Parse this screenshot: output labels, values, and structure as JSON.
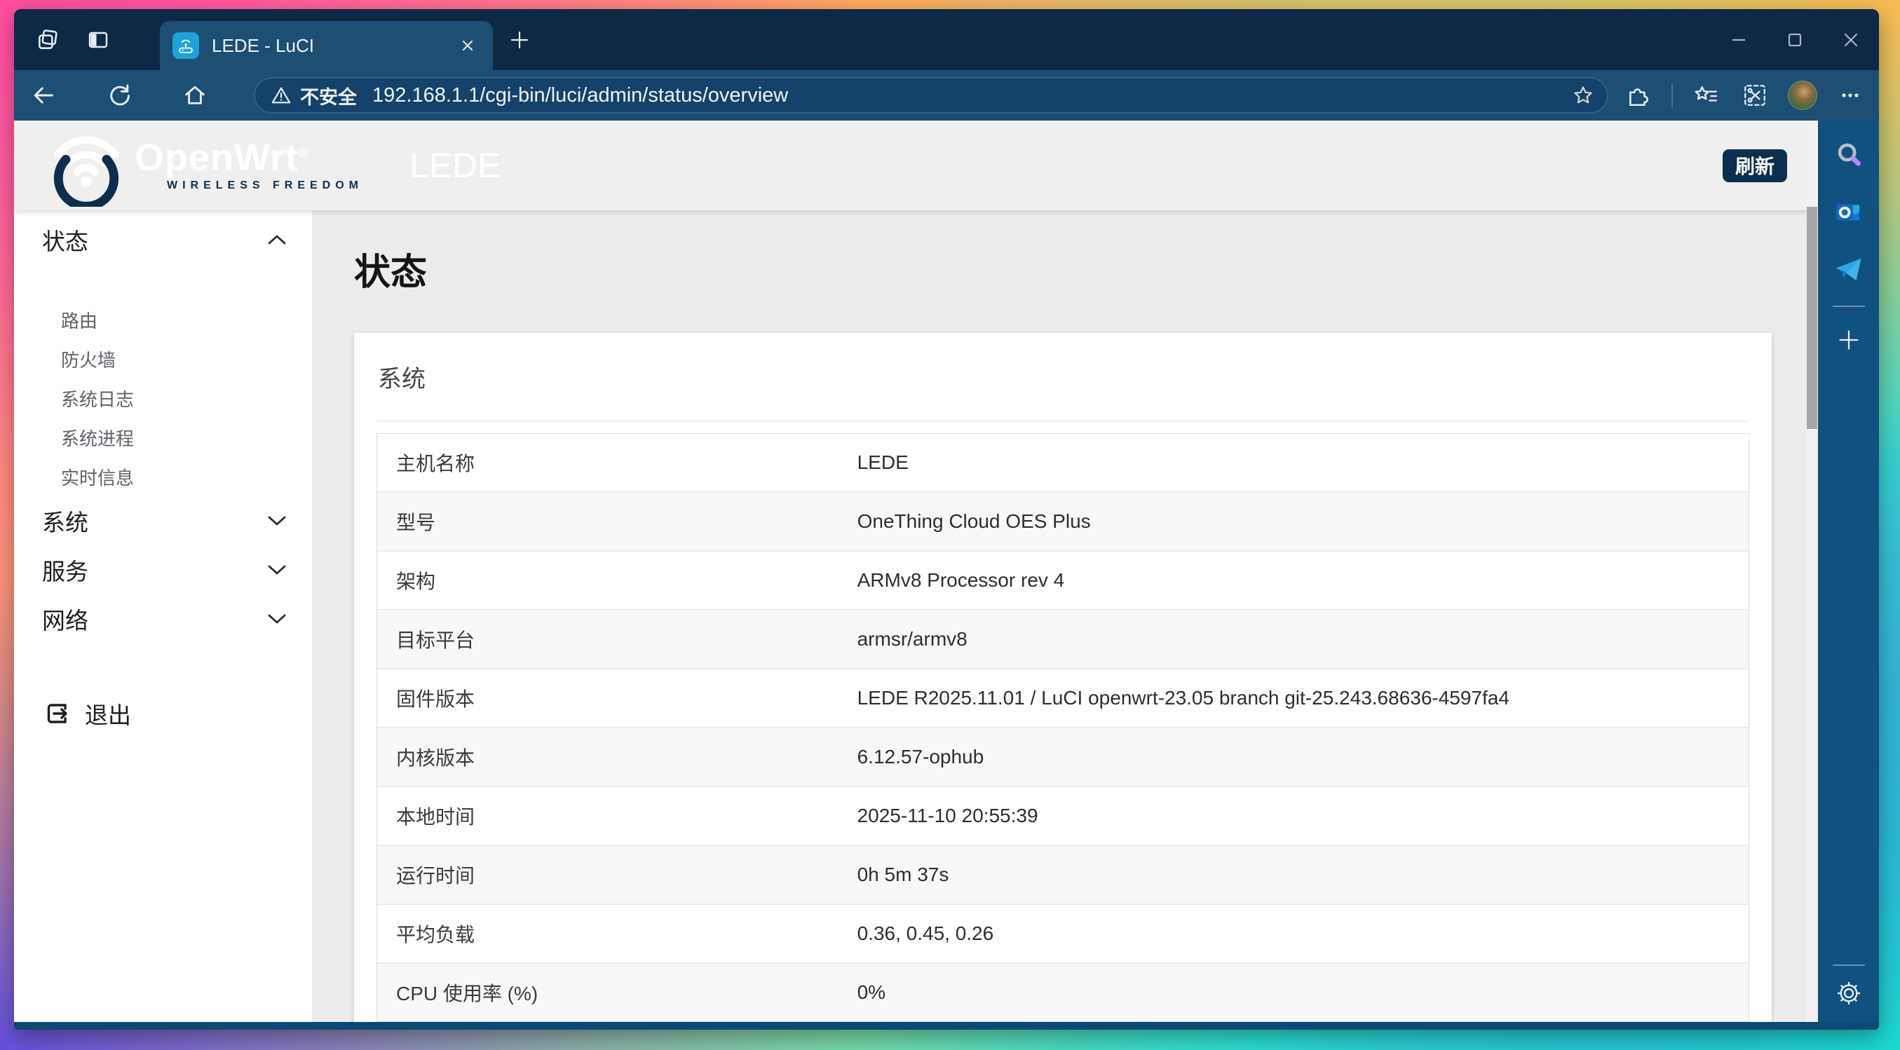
{
  "browser": {
    "tab_title": "LEDE - LuCI",
    "security_label": "不安全",
    "url": "192.168.1.1/cgi-bin/luci/admin/status/overview"
  },
  "luci": {
    "brand": "OpenWrt",
    "brand_mark": "®",
    "brand_tagline": "WIRELESS FREEDOM",
    "site_title": "LEDE",
    "refresh_button": "刷新",
    "nav": {
      "status_group": "状态",
      "status_items": [
        "路由",
        "防火墙",
        "系统日志",
        "系统进程",
        "实时信息"
      ],
      "system_group": "系统",
      "services_group": "服务",
      "network_group": "网络",
      "logout": "退出"
    },
    "page_title": "状态",
    "section_title": "系统",
    "system_table": [
      {
        "label": "主机名称",
        "value": "LEDE"
      },
      {
        "label": "型号",
        "value": "OneThing Cloud OES Plus"
      },
      {
        "label": "架构",
        "value": "ARMv8 Processor rev 4"
      },
      {
        "label": "目标平台",
        "value": "armsr/armv8"
      },
      {
        "label": "固件版本",
        "value": "LEDE R2025.11.01 / LuCI openwrt-23.05 branch git-25.243.68636-4597fa4"
      },
      {
        "label": "内核版本",
        "value": "6.12.57-ophub"
      },
      {
        "label": "本地时间",
        "value": "2025-11-10 20:55:39"
      },
      {
        "label": "运行时间",
        "value": "0h 5m 37s"
      },
      {
        "label": "平均负载",
        "value": "0.36, 0.45, 0.26"
      },
      {
        "label": "CPU 使用率 (%)",
        "value": "0%"
      }
    ]
  },
  "colors": {
    "titlebar": "#0e2946",
    "toolbar": "#1d4e74",
    "edge_sidebar": "#11517f",
    "accent_navy": "#0d2f4e",
    "favicon_blue": "#1da2da",
    "page_bg": "#ececec"
  }
}
